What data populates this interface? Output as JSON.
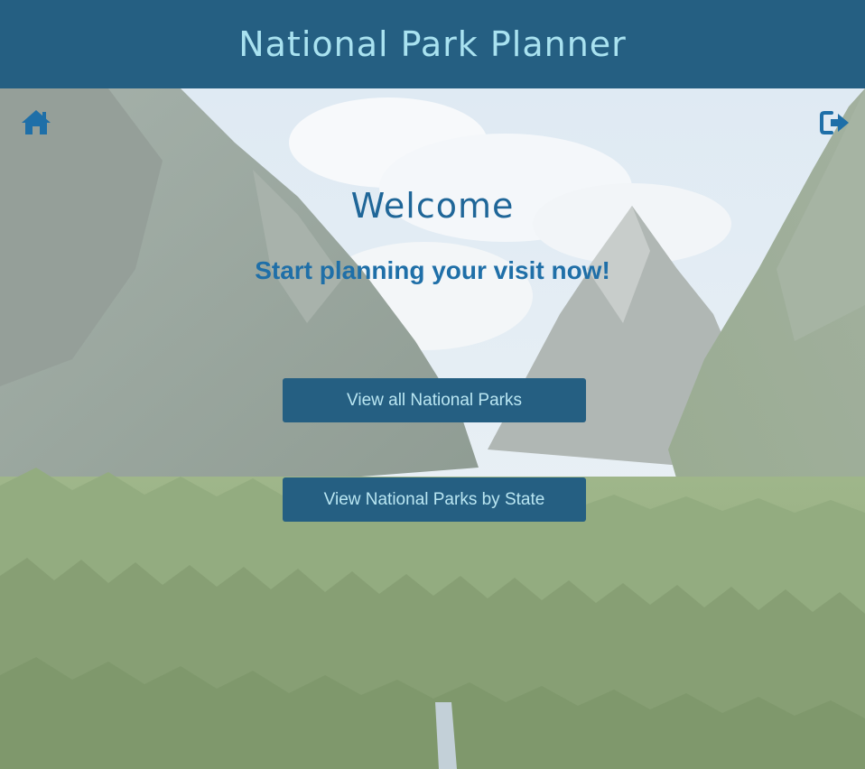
{
  "header": {
    "title": "National Park Planner"
  },
  "nav": {
    "home_icon": "home-icon",
    "signout_icon": "sign-out-icon"
  },
  "main": {
    "heading": "Welcome",
    "subheading": "Start planning your visit now!",
    "buttons": {
      "view_all": "View all National Parks",
      "view_by_state": "View National Parks by State"
    }
  },
  "colors": {
    "header_bg": "#255f82",
    "header_text": "#a9e2f0",
    "accent": "#1f6698",
    "button_bg": "#255f82",
    "button_text": "#b9e6f2"
  }
}
